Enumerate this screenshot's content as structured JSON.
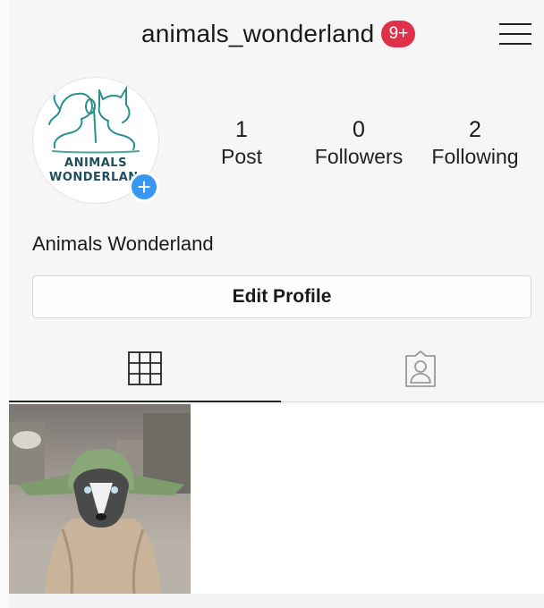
{
  "header": {
    "username": "animals_wonderland",
    "notification_badge": "9+",
    "menu_icon": "hamburger-menu-icon"
  },
  "profile": {
    "avatar_text_line1": "ANIMALS",
    "avatar_text_line2": "WONDERLAN",
    "add_icon": "plus-icon",
    "display_name": "Animals Wonderland"
  },
  "stats": [
    {
      "value": "1",
      "label": "Post"
    },
    {
      "value": "0",
      "label": "Followers"
    },
    {
      "value": "2",
      "label": "Following"
    }
  ],
  "actions": {
    "edit_profile_label": "Edit Profile"
  },
  "tabs": [
    {
      "icon": "grid-icon",
      "active": true
    },
    {
      "icon": "tagged-person-icon",
      "active": false
    }
  ],
  "posts": [
    {
      "thumbnail": "husky-in-yoda-costume"
    }
  ],
  "colors": {
    "badge": "#e0314b",
    "add_button": "#3897f0",
    "logo": "#2a8f8f"
  }
}
